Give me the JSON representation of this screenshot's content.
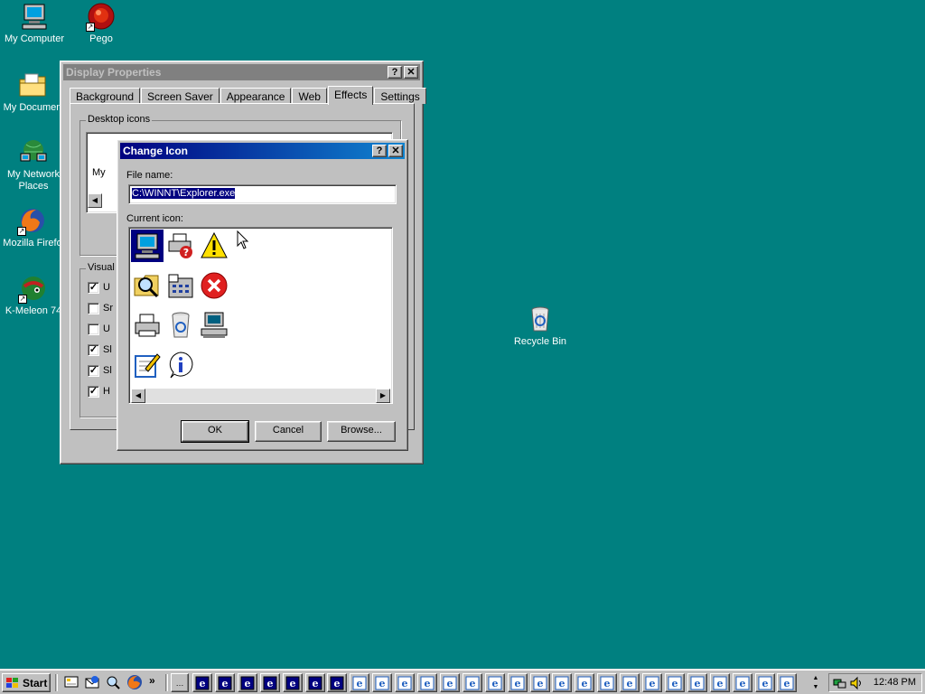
{
  "desktop": {
    "icons": [
      {
        "label": "My Computer"
      },
      {
        "label": "Pego"
      },
      {
        "label": "My Documen"
      },
      {
        "label": "My Network",
        "label2": "Places"
      },
      {
        "label": "Mozilla Firefo"
      },
      {
        "label": "K-Meleon 74"
      },
      {
        "label": "Recycle Bin"
      }
    ]
  },
  "display_properties": {
    "title": "Display Properties",
    "help": "?",
    "close": "✕",
    "tabs": [
      "Background",
      "Screen Saver",
      "Appearance",
      "Web",
      "Effects",
      "Settings"
    ],
    "selected_tab": "Effects",
    "desktop_icons_group": "Desktop icons",
    "desktop_icon_partial_label": "My",
    "visual_effects_group": "Visual",
    "visual_options": [
      {
        "label": "U",
        "checked": true
      },
      {
        "label": "Sr",
        "checked": false
      },
      {
        "label": "U",
        "checked": false
      },
      {
        "label": "Sl",
        "checked": true
      },
      {
        "label": "Sl",
        "checked": true
      },
      {
        "label": "H",
        "checked": true
      }
    ]
  },
  "change_icon": {
    "title": "Change Icon",
    "help": "?",
    "close": "✕",
    "file_name_label": "File name:",
    "file_name_value": "C:\\WINNT\\Explorer.exe",
    "current_icon_label": "Current icon:",
    "icons": [
      "computer-icon",
      "printer-help-icon",
      "warning-icon",
      "search-folder-icon",
      "control-panel-icon",
      "error-icon",
      "printer-icon",
      "recycle-bin-icon",
      "network-computer-icon",
      "notepad-icon",
      "info-icon"
    ],
    "ok": "OK",
    "cancel": "Cancel",
    "browse": "Browse..."
  },
  "taskbar": {
    "start": "Start",
    "chevron": "»",
    "clock": "12:48 PM",
    "task_count": 27
  }
}
